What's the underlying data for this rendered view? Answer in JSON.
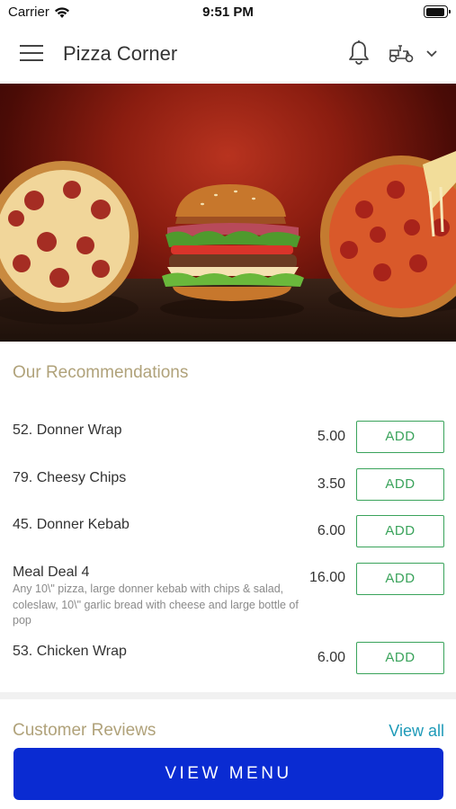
{
  "status_bar": {
    "carrier": "Carrier",
    "time": "9:51 PM",
    "battery_level": 0.95
  },
  "header": {
    "title": "Pizza Corner",
    "menu_icon": "hamburger-menu-icon",
    "bell_icon": "bell-icon",
    "delivery_icon": "scooter-delivery-icon",
    "dropdown_icon": "chevron-down-icon"
  },
  "hero": {
    "image": "pizza-burger-banner"
  },
  "recommendations": {
    "title": "Our Recommendations",
    "items": [
      {
        "name": "52. Donner Wrap",
        "price": "5.00",
        "add_label": "ADD"
      },
      {
        "name": "79. Cheesy Chips",
        "price": "3.50",
        "add_label": "ADD"
      },
      {
        "name": "45. Donner Kebab",
        "price": "6.00",
        "add_label": "ADD"
      },
      {
        "name": "Meal Deal 4",
        "price": "16.00",
        "add_label": "ADD",
        "description": "Any 10\\\" pizza, large donner kebab with chips & salad, coleslaw, 10\\\" garlic bread with cheese and large bottle of pop"
      },
      {
        "name": "53. Chicken Wrap",
        "price": "6.00",
        "add_label": "ADD"
      }
    ]
  },
  "reviews": {
    "title": "Customer Reviews",
    "view_all_label": "View all"
  },
  "footer": {
    "view_menu_label": "VIEW MENU"
  },
  "colors": {
    "accent_green": "#3aa35b",
    "primary_blue": "#0a2bd2",
    "link_blue": "#1e9ab8",
    "section_title": "#b0a27a"
  }
}
